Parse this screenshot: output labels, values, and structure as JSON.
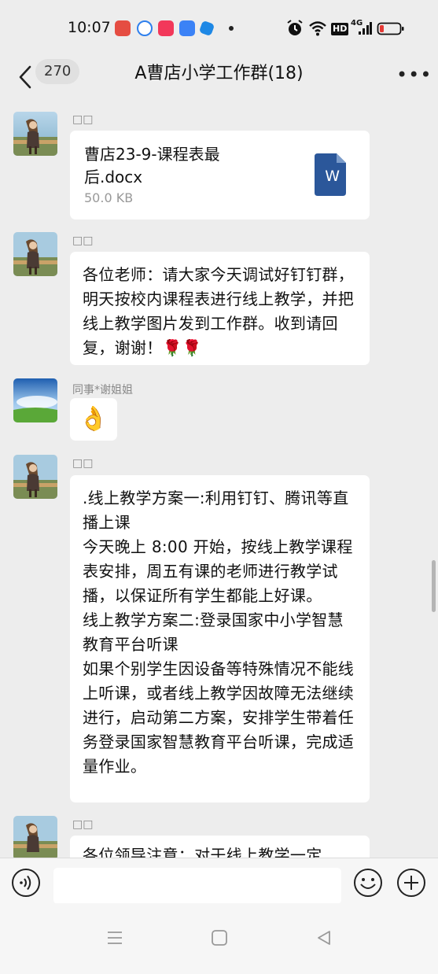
{
  "status": {
    "time": "10:07",
    "network": "HD",
    "signal": "4G"
  },
  "header": {
    "unread_count": "270",
    "title": "A曹店小学工作群(18)"
  },
  "messages": [
    {
      "sender": "□□",
      "type": "file",
      "file_name": "曹店23-9-课程表最后.docx",
      "file_size": "50.0 KB",
      "file_icon_letter": "W"
    },
    {
      "sender": "□□",
      "type": "text",
      "text": "各位老师：请大家今天调试好钉钉群，明天按校内课程表进行线上教学，并把线上教学图片发到工作群。收到请回复，谢谢！🌹🌹"
    },
    {
      "sender": "同事*谢姐姐",
      "type": "emoji",
      "text": "👌"
    },
    {
      "sender": "□□",
      "type": "text",
      "text": ".线上教学方案一:利用钉钉、腾讯等直播上课\n今天晚上 8:00 开始，按线上教学课程表安排，周五有课的老师进行教学试播，以保证所有学生都能上好课。\n线上教学方案二:登录国家中小学智慧教育平台听课\n如果个别学生因设备等特殊情况不能线上听课，或者线上教学因故障无法继续进行，启动第二方案，安排学生带着任务登录国家智慧教育平台听课，完成适量作业。"
    },
    {
      "sender": "□□",
      "type": "text",
      "text": "各位领导注意：对于线上教学一定"
    }
  ],
  "composer": {
    "placeholder": ""
  },
  "icons": {
    "back": "chevron-left-icon",
    "more": "more-icon",
    "voice": "voice-icon",
    "emoji": "emoji-icon",
    "plus": "plus-icon",
    "nav_menu": "menu-icon",
    "nav_home": "home-icon",
    "nav_back": "back-triangle-icon"
  },
  "colors": {
    "background": "#ededed",
    "bubble": "#ffffff",
    "word_blue": "#2b579a",
    "battery_red": "#e53935"
  }
}
